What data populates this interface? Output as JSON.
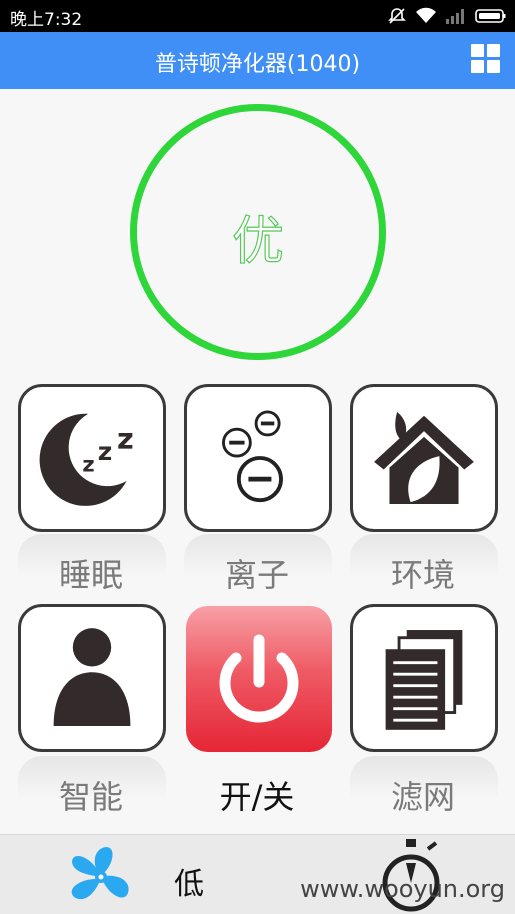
{
  "status_bar": {
    "time": "晚上7:32",
    "icons": [
      "mute-icon",
      "wifi-icon",
      "signal-icon",
      "battery-icon"
    ]
  },
  "header": {
    "title": "普诗顿净化器(1040)",
    "menu_icon": "grid-icon"
  },
  "air_quality": {
    "text": "优",
    "ring_color": "#2ed63a"
  },
  "tiles": [
    {
      "label": "睡眠",
      "icon": "sleep-moon-icon"
    },
    {
      "label": "离子",
      "icon": "ion-icon"
    },
    {
      "label": "环境",
      "icon": "environment-house-icon"
    },
    {
      "label": "智能",
      "icon": "person-icon"
    },
    {
      "label": "开/关",
      "icon": "power-icon"
    },
    {
      "label": "滤网",
      "icon": "filter-pages-icon"
    }
  ],
  "bottom_bar": {
    "fan_icon": "fan-icon",
    "speed": "低",
    "timer_icon": "timer-icon"
  },
  "watermark": "www.wooyun.org",
  "colors": {
    "header": "#3f8ff6",
    "ring": "#2ed63a",
    "power": "#e52636",
    "fan": "#2aa8f0"
  }
}
